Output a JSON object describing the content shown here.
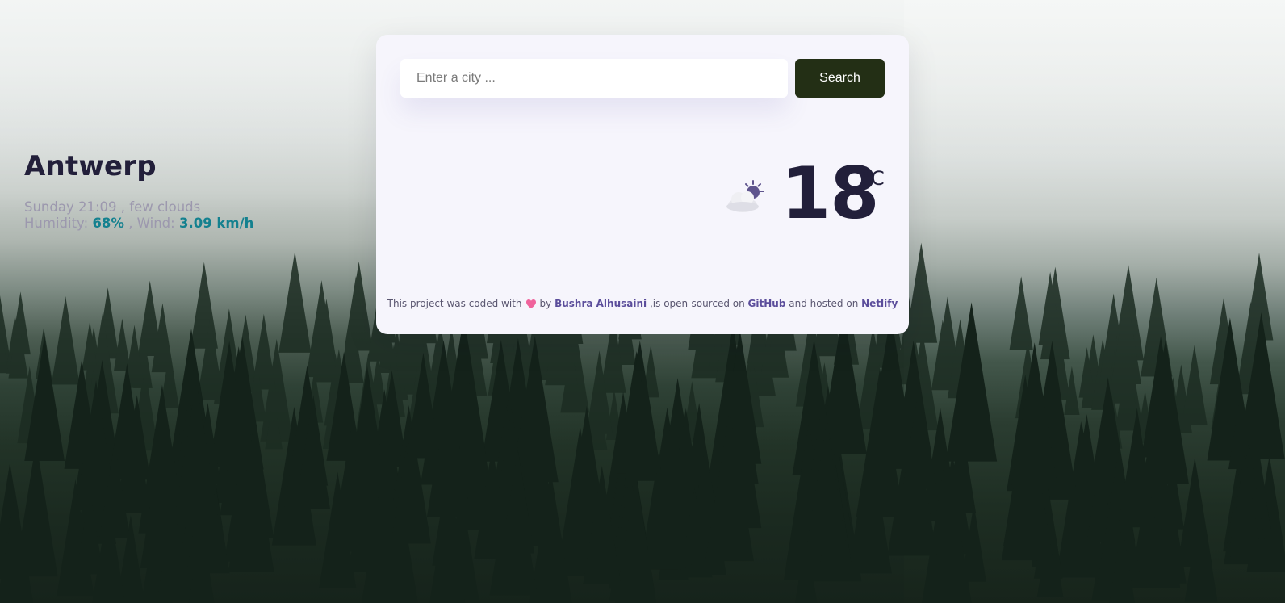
{
  "search": {
    "placeholder": "Enter a city ...",
    "button_label": "Search"
  },
  "weather": {
    "city": "Antwerp",
    "datetime_description": "Sunday 21:09 , few clouds",
    "humidity_label": "Humidity:",
    "humidity_value": "68%",
    "wind_label": ", Wind:",
    "wind_value": "3.09 km/h",
    "temperature": "18",
    "unit": "°C",
    "icon": "few-clouds-night-icon"
  },
  "footer": {
    "text_before": "This project was coded with",
    "heart_icon": "heart-icon",
    "text_by": "by",
    "author": "Bushra Alhusaini",
    "text_open_source": ",is open-sourced on",
    "github": "GitHub",
    "text_hosted": "and hosted on",
    "netlify": "Netlify"
  },
  "colors": {
    "search_button": "#232f15",
    "card_background": "#f6f5fc",
    "value_highlight": "#14818f",
    "link": "#5b4d9b",
    "heart": "#f0639c"
  }
}
